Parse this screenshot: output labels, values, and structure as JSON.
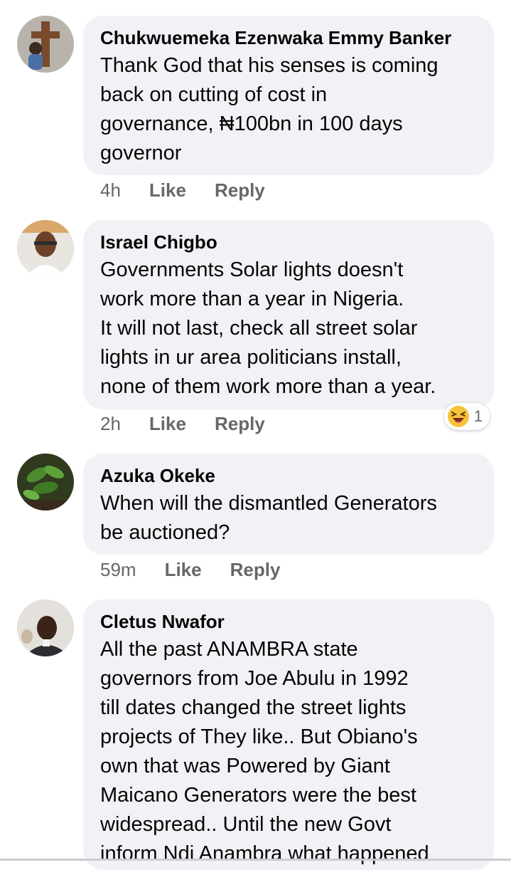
{
  "comments": [
    {
      "author": "Chukwuemeka Ezenwaka Emmy Banker",
      "text": "Thank God that his senses is coming\nback on cutting of cost in\ngovernance, ₦100bn in 100 days\ngovernor",
      "time": "4h",
      "like_label": "Like",
      "reply_label": "Reply"
    },
    {
      "author": "Israel Chigbo",
      "text": "Governments Solar lights doesn't\nwork more than a year in Nigeria.\nIt will not last, check all street solar\nlights in ur area politicians install,\nnone of them work more than a year.",
      "time": "2h",
      "like_label": "Like",
      "reply_label": "Reply",
      "reaction": {
        "icon": "laughing-emoji-icon",
        "count": "1"
      }
    },
    {
      "author": "Azuka Okeke",
      "text": "When will the dismantled Generators\nbe auctioned?",
      "time": "59m",
      "like_label": "Like",
      "reply_label": "Reply"
    },
    {
      "author": "Cletus Nwafor",
      "text": "All the past ANAMBRA state\ngovernors from Joe Abulu in 1992\ntill dates changed the street lights\nprojects of They like.. But Obiano's\nown that was Powered by Giant\nMaicano Generators were the best\nwidespread.. Until the new Govt\ninform Ndi Anambra what happened"
    }
  ],
  "colors": {
    "bubble_bg": "#f0f2f5",
    "meta_text": "#65676b",
    "emoji_yellow": "#f7c43a"
  }
}
